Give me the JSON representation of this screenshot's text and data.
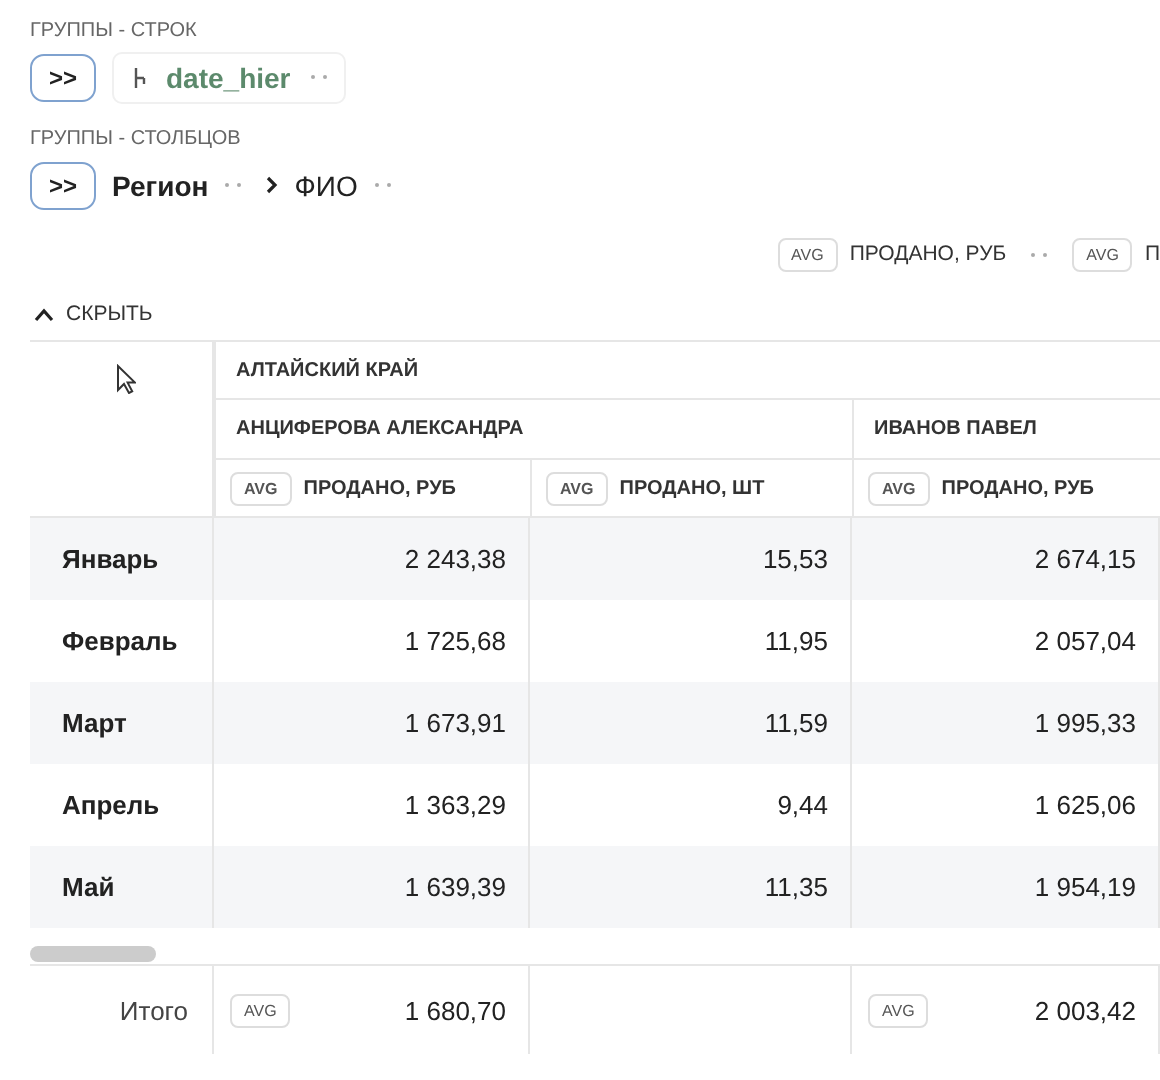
{
  "row_groups": {
    "label": "ГРУППЫ - СТРОК",
    "expand_button": ">>",
    "fields": [
      {
        "name": "date_hier",
        "kind": "hierarchy"
      }
    ]
  },
  "column_groups": {
    "label": "ГРУППЫ - СТОЛБЦОВ",
    "expand_button": ">>",
    "fields": [
      {
        "name": "Регион",
        "kind": "field"
      },
      {
        "name": "ФИО",
        "kind": "field"
      }
    ]
  },
  "measures": [
    {
      "aggregation": "AVG",
      "name": "ПРОДАНО, РУБ"
    },
    {
      "aggregation": "AVG",
      "name": "П"
    }
  ],
  "collapse_toggle": "СКРЫТЬ",
  "table": {
    "regions": [
      {
        "name": "АЛТАЙСКИЙ КРАЙ",
        "people": [
          {
            "name": "АНЦИФЕРОВА АЛЕКСАНДРА",
            "measures": [
              {
                "aggregation": "AVG",
                "name": "ПРОДАНО, РУБ"
              },
              {
                "aggregation": "AVG",
                "name": "ПРОДАНО, ШТ"
              }
            ]
          },
          {
            "name": "ИВАНОВ ПАВЕЛ",
            "measures": [
              {
                "aggregation": "AVG",
                "name": "ПРОДАНО, РУБ"
              }
            ]
          }
        ]
      }
    ],
    "rows": [
      {
        "label": "Январь",
        "values": [
          "2 243,38",
          "15,53",
          "2 674,15"
        ]
      },
      {
        "label": "Февраль",
        "values": [
          "1 725,68",
          "11,95",
          "2 057,04"
        ]
      },
      {
        "label": "Март",
        "values": [
          "1 673,91",
          "11,59",
          "1 995,33"
        ]
      },
      {
        "label": "Апрель",
        "values": [
          "1 363,29",
          "9,44",
          "1 625,06"
        ]
      },
      {
        "label": "Май",
        "values": [
          "1 639,39",
          "11,35",
          "1 954,19"
        ]
      }
    ],
    "total": {
      "label": "Итого",
      "cells": [
        {
          "aggregation": "AVG",
          "value": "1 680,70"
        },
        null,
        {
          "aggregation": "AVG",
          "value": "2 003,42"
        }
      ]
    }
  }
}
